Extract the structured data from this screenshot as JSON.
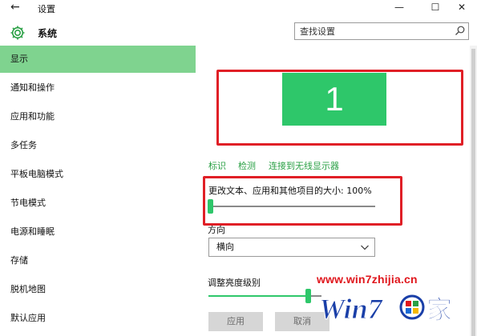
{
  "window": {
    "title": "设置",
    "back_icon": "back-arrow-icon",
    "minimize_glyph": "—",
    "maximize_glyph": "☐",
    "close_glyph": "✕"
  },
  "header": {
    "title": "系统",
    "icon": "gear-icon",
    "search_placeholder": "查找设置"
  },
  "sidebar": {
    "accent_color": "#7fd38f",
    "items": [
      {
        "label": "显示",
        "active": true
      },
      {
        "label": "通知和操作"
      },
      {
        "label": "应用和功能"
      },
      {
        "label": "多任务"
      },
      {
        "label": "平板电脑模式"
      },
      {
        "label": "节电模式"
      },
      {
        "label": "电源和睡眠"
      },
      {
        "label": "存储"
      },
      {
        "label": "脱机地图"
      },
      {
        "label": "默认应用"
      }
    ]
  },
  "display": {
    "monitor_number": "1",
    "monitor_color": "#2ec76a",
    "links": [
      "标识",
      "检测",
      "连接到无线显示器"
    ],
    "scale_label": "更改文本、应用和其他项目的大小: 100%",
    "scale_value_percent": 0,
    "orientation_label": "方向",
    "orientation_value": "横向",
    "brightness_label": "调整亮度级别",
    "brightness_value_percent": 88,
    "apply_label": "应用",
    "cancel_label": "取消"
  },
  "annotation": {
    "highlight_color": "#e01f26"
  },
  "watermark": {
    "url": "www.win7zhijia.cn",
    "logo_text": "Win7",
    "logo_suffix": "家"
  }
}
